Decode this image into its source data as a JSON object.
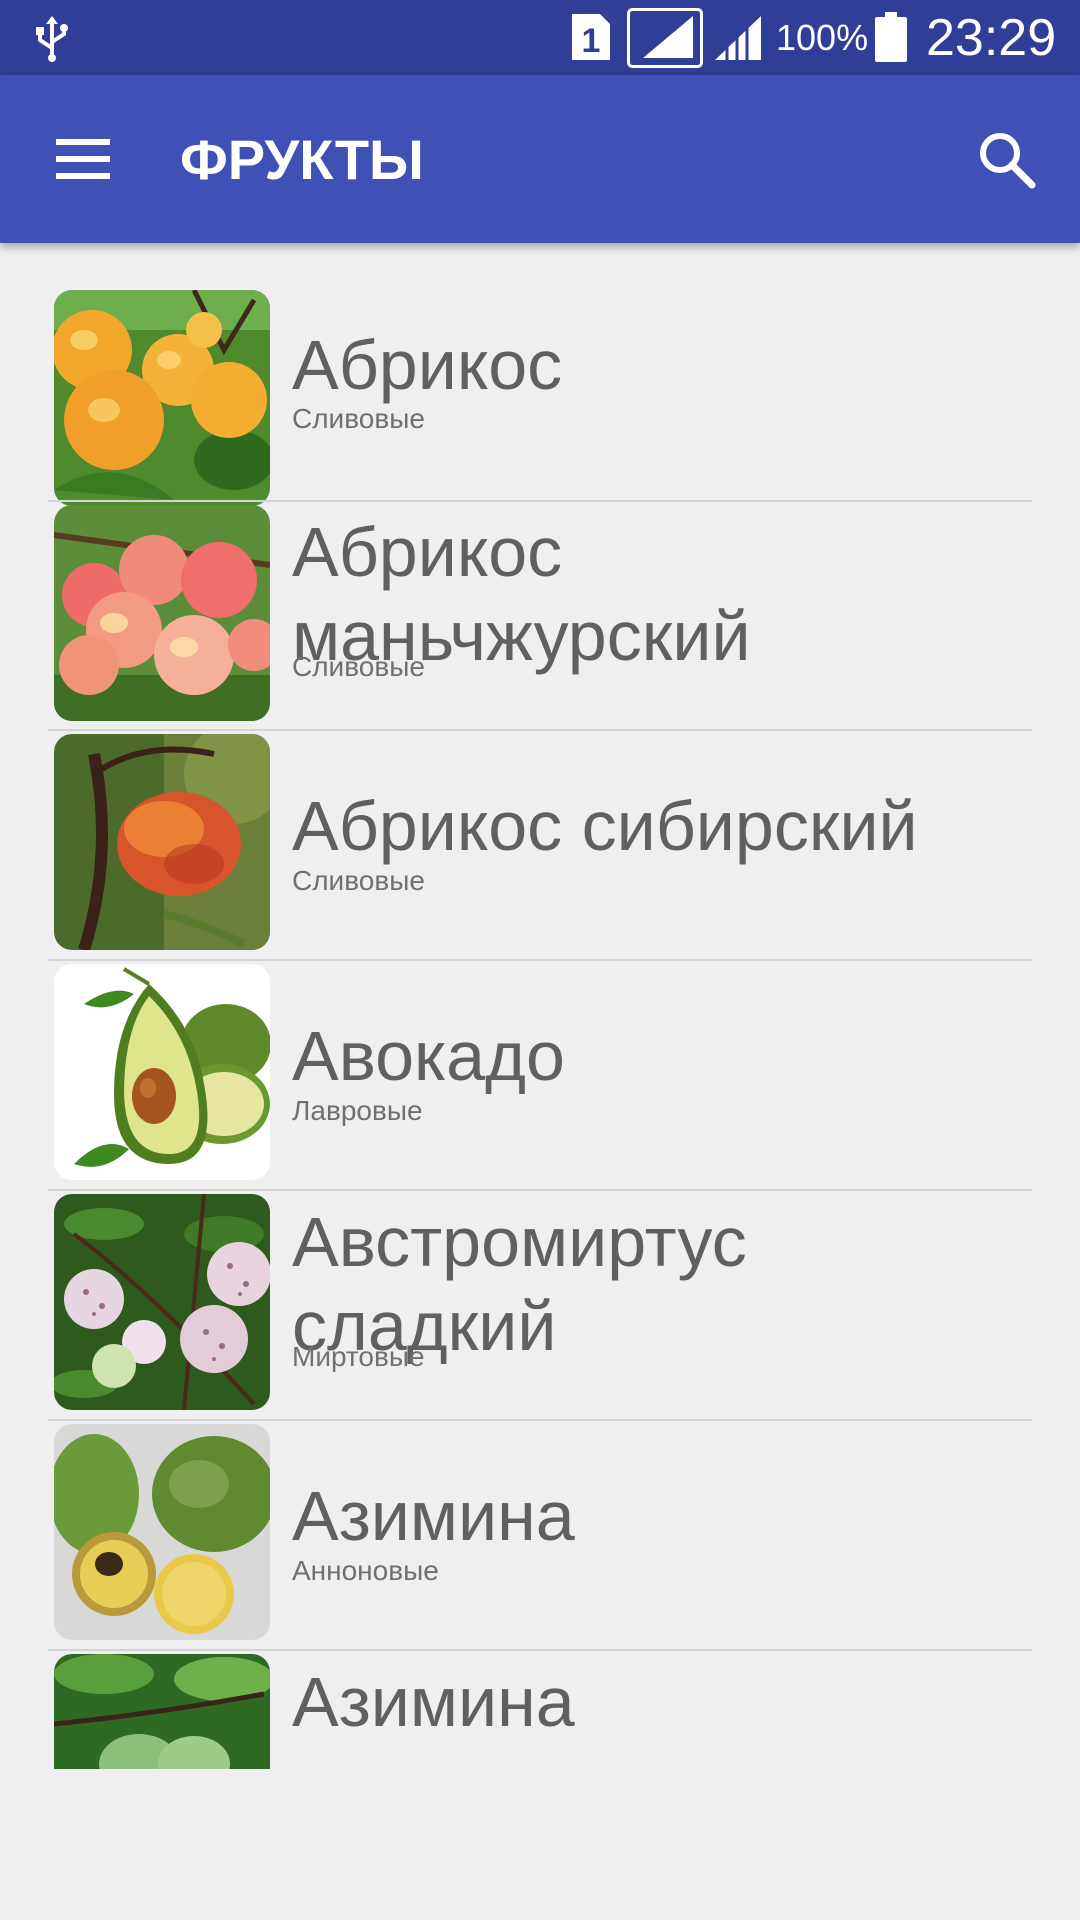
{
  "status_bar": {
    "battery_percent": "100%",
    "time": "23:29",
    "sim_slot": "1",
    "icons": [
      "usb-icon",
      "sim-icon",
      "signal-icon",
      "signal-icon",
      "battery-icon"
    ]
  },
  "app_bar": {
    "title": "ФРУКТЫ",
    "menu_icon": "hamburger-menu-icon",
    "search_icon": "search-icon"
  },
  "colors": {
    "status_bar": "#2f3e97",
    "app_bar": "#3f51b5",
    "background": "#efeef0",
    "item_title": "#606060",
    "item_subtitle": "#707070"
  },
  "fruits": [
    {
      "name": "Абрикос",
      "family": "Сливовые"
    },
    {
      "name": "Абрикос маньчжурский",
      "family": "Сливовые"
    },
    {
      "name": "Абрикос сибирский",
      "family": "Сливовые"
    },
    {
      "name": "Авокадо",
      "family": "Лавровые"
    },
    {
      "name": "Австромиртус сладкий",
      "family": "Миртовые"
    },
    {
      "name": "Азимина",
      "family": "Аннонoвые"
    },
    {
      "name": "Азимина",
      "family": ""
    }
  ]
}
